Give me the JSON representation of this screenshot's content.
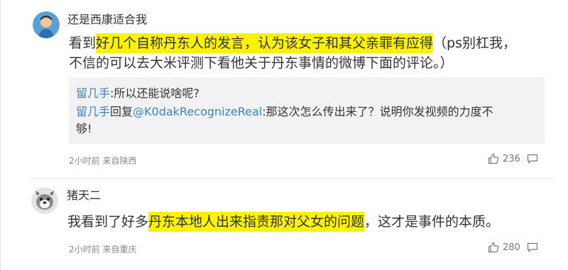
{
  "comments": [
    {
      "username": "还是西康适合我",
      "content_lines": [
        [
          {
            "text": "看到",
            "hl": false
          },
          {
            "text": "好几个自称丹东人的发言，认为该女子和其父亲罪有应得",
            "hl": true
          },
          {
            "text": "（ps别杠我，",
            "hl": false
          }
        ],
        [
          {
            "text": "不信的可以去大米评测下看他关于丹东事情的微博下面的评论。）",
            "hl": false
          }
        ]
      ],
      "replies": [
        {
          "user": "留几手",
          "text": ":所以还能说啥呢?"
        },
        {
          "user": "留几手",
          "prefix": "回复",
          "mention": "@K0dakRecognizeReal",
          "text": ":那这次怎么传出来了？说明你发视频的力度不",
          "cont": "够!"
        }
      ],
      "meta": "2小时前 来自陕西",
      "likes": "236"
    },
    {
      "username": "猪天二",
      "content_lines": [
        [
          {
            "text": "我看到了好多",
            "hl": false
          },
          {
            "text": "丹东本地人出来指责那对父女的问题",
            "hl": true
          },
          {
            "text": "，这才是事件的本质。",
            "hl": false
          }
        ]
      ],
      "meta": "2小时前 来自重庆",
      "likes": "280"
    }
  ],
  "colors": {
    "highlight": "#fff200",
    "link": "#3b82c4",
    "text": "#333333",
    "meta": "#8a8a8a"
  },
  "icons": {
    "like": "thumbs-up-icon",
    "reply": "comment-icon"
  }
}
